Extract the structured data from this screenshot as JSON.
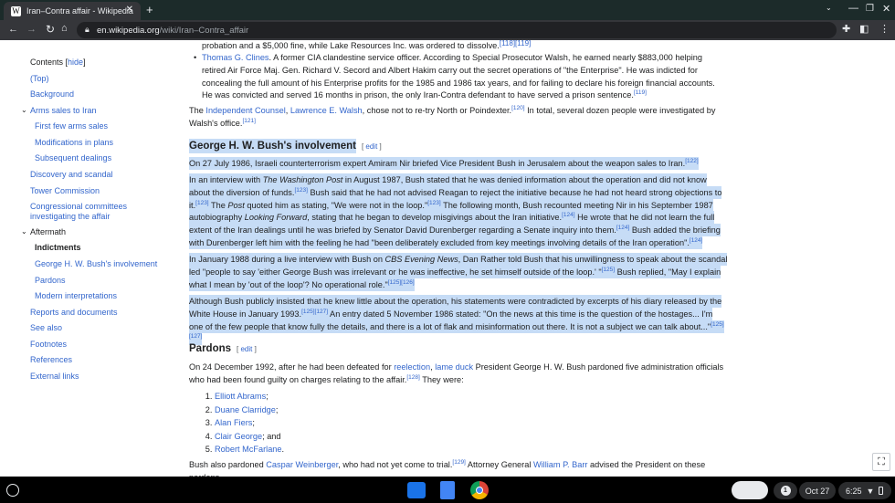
{
  "browser": {
    "tab_title": "Iran–Contra affair - Wikipedia",
    "url_domain": "en.wikipedia.org",
    "url_path": "/wiki/Iran–Contra_affair"
  },
  "toc": {
    "title": "Contents",
    "hide": "hide",
    "items": [
      "(Top)",
      "Background",
      "Arms sales to Iran",
      "First few arms sales",
      "Modifications in plans",
      "Subsequent dealings",
      "Discovery and scandal",
      "Tower Commission",
      "Congressional committees investigating the affair",
      "Aftermath",
      "Indictments",
      "George H. W. Bush's involvement",
      "Pardons",
      "Modern interpretations",
      "Reports and documents",
      "See also",
      "Footnotes",
      "References",
      "External links"
    ]
  },
  "content": {
    "p0": "probation and a $5,000 fine, while Lake Resources Inc. was ordered to dissolve.",
    "p0_refs": "[118][119]",
    "clines_link": "Thomas G. Clines",
    "clines_text": ". A former CIA clandestine service officer. According to Special Prosecutor Walsh, he earned nearly $883,000 helping retired Air Force Maj. Gen. Richard V. Secord and Albert Hakim carry out the secret operations of \"the Enterprise\". He was indicted for concealing the full amount of his Enterprise profits for the 1985 and 1986 tax years, and for failing to declare his foreign financial accounts. He was convicted and served 16 months in prison, the only Iran-Contra defendant to have served a prison sentence.",
    "clines_ref": "[119]",
    "p1a": "The ",
    "p1_link1": "Independent Counsel",
    "p1_comma": ", ",
    "p1_link2": "Lawrence E. Walsh",
    "p1b": ", chose not to re-try North or Poindexter.",
    "p1_ref1": "[120]",
    "p1c": " In total, several dozen people were investigated by Walsh's office.",
    "p1_ref2": "[121]",
    "h_bush": "George H. W. Bush's involvement",
    "edit": "edit",
    "b1": "On 27 July 1986, Israeli counterterrorism expert Amiram Nir briefed Vice President Bush in Jerusalem about the weapon sales to Iran.",
    "b1_ref": "[122]",
    "b2a": "In an interview with ",
    "b2_wp": "The Washington Post",
    "b2b": " in August 1987, Bush stated that he was denied information about the operation and did not know about the diversion of funds.",
    "r123": "[123]",
    "b2c": " Bush said that he had not advised Reagan to reject the initiative because he had not heard strong objections to it.",
    "b2d": " The ",
    "b2_post": "Post",
    "b2e": " quoted him as stating, \"We were not in the loop.\"",
    "b2f": " The following month, Bush recounted meeting Nir in his September 1987 autobiography ",
    "b2_lf": "Looking Forward",
    "b2g": ", stating that he began to develop misgivings about the Iran initiative.",
    "r124": "[124]",
    "b2h": " He wrote that he did not learn the full extent of the Iran dealings until he was briefed by Senator David Durenberger regarding a Senate inquiry into them.",
    "b2i": " Bush added the briefing with Durenberger left him with the feeling he had \"been deliberately excluded from key meetings involving details of the Iran operation\".",
    "b3a": "In January 1988 during a live interview with Bush on ",
    "b3_cbs": "CBS Evening News",
    "b3b": ", Dan Rather told Bush that his unwillingness to speak about the scandal led \"people to say 'either George Bush was irrelevant or he was ineffective, he set himself outside of the loop.' \"",
    "r125": "[125]",
    "b3c": " Bush replied, \"May I explain what I mean by 'out of the loop'? No operational role.\"",
    "r125_126": "[125][126]",
    "b4a": "Although Bush publicly insisted that he knew little about the operation, his statements were contradicted by excerpts of his diary released by the White House in January 1993.",
    "r125_127": "[125][127]",
    "b4b": " An entry dated 5 November 1986 stated: \"On the news at this time is the question of the hostages... I'm one of the few people that know fully the details, and there is a lot of flak and misinformation out there. It is not a subject we can talk about...\"",
    "h_pardons": "Pardons",
    "pa1": "On 24 December 1992, after he had been defeated for ",
    "pa_reelection": "reelection",
    "pa_comma": ", ",
    "pa_lameduck": "lame duck",
    "pa2": " President George H. W. Bush pardoned five administration officials who had been found guilty on charges relating to the affair.",
    "r128": "[128]",
    "pa3": " They were:",
    "pardoned": [
      {
        "name": "Elliott Abrams",
        "suffix": ";"
      },
      {
        "name": "Duane Clarridge",
        "suffix": ";"
      },
      {
        "name": "Alan Fiers",
        "suffix": ";"
      },
      {
        "name": "Clair George",
        "suffix": "; and"
      },
      {
        "name": "Robert McFarlane",
        "suffix": "."
      }
    ],
    "last1": "Bush also pardoned ",
    "last_cw": "Caspar Weinberger",
    "last2": ", who had not yet come to trial.",
    "r129": "[129]",
    "last3": " Attorney General ",
    "last_barr": "William P. Barr",
    "last4": " advised the President on these pardons,"
  },
  "shelf": {
    "notifications": "1",
    "date": "Oct 27",
    "time": "6:25"
  }
}
